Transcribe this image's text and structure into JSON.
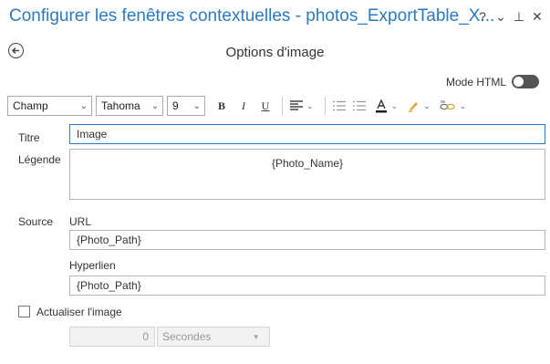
{
  "window": {
    "title": "Configurer les fenêtres contextuelles - photos_ExportTable_X...",
    "help": "?",
    "menu": "⌄",
    "pin": "⊥",
    "close": "✕"
  },
  "header": {
    "subtitle": "Options d'image"
  },
  "html_mode": {
    "label": "Mode HTML",
    "on": false
  },
  "toolbar": {
    "field_select": "Champ",
    "font_select": "Tahoma",
    "size_select": "9",
    "bold": "B",
    "italic": "I",
    "underline": "U"
  },
  "form": {
    "title_label": "Titre",
    "title_value": "Image",
    "caption_label": "Légende",
    "caption_value": "{Photo_Name}",
    "source_label": "Source",
    "url_label": "URL",
    "url_value": "{Photo_Path}",
    "hyperlink_label": "Hyperlien",
    "hyperlink_value": "{Photo_Path}",
    "refresh_label": "Actualiser l'image",
    "refresh_checked": false,
    "interval_value": "0",
    "interval_unit": "Secondes"
  }
}
